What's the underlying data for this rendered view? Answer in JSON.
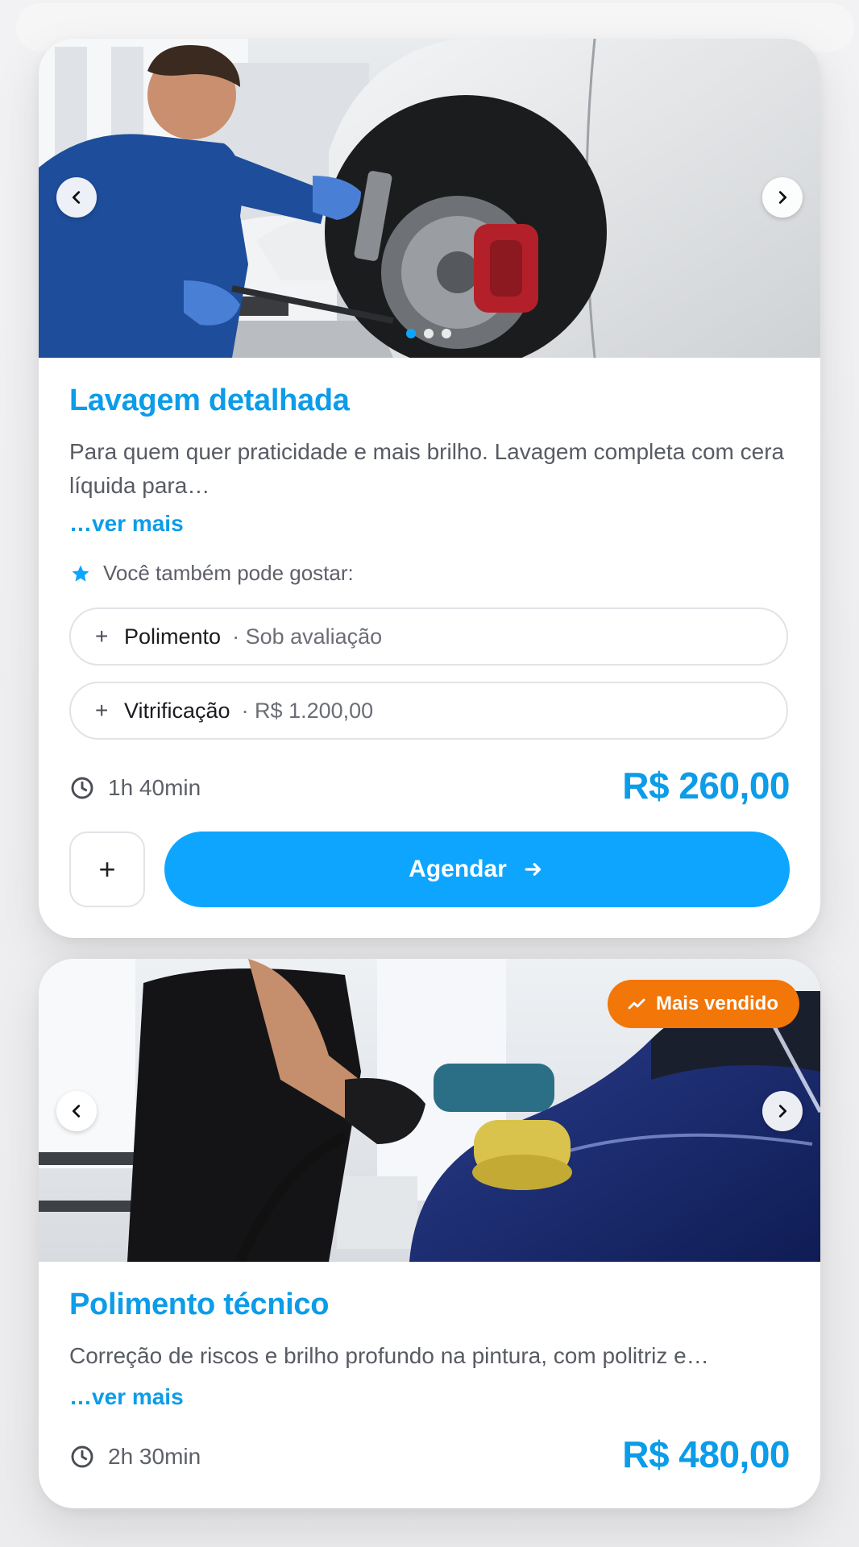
{
  "services": [
    {
      "title": "Lavagem detalhada",
      "description": "Para quem quer praticidade e mais brilho. Lavagem completa com cera líquida para…",
      "more_label": "…ver mais",
      "suggest_label": "Você também pode gostar:",
      "suggestions": [
        {
          "name": "Polimento",
          "detail": "· Sob avaliação"
        },
        {
          "name": "Vitrificação",
          "detail": "· R$ 1.200,00"
        }
      ],
      "duration": "1h 40min",
      "price": "R$ 260,00",
      "add_label": "+",
      "book_label": "Agendar",
      "carousel": {
        "slide": 1,
        "total": 3
      }
    },
    {
      "title": "Polimento técnico",
      "description": "Correção de riscos e brilho profundo na pintura, com politriz e…",
      "more_label": "…ver mais",
      "badge": "Mais vendido",
      "duration": "2h 30min",
      "price": "R$ 480,00"
    }
  ],
  "icons": {
    "prev": "chevron-left-icon",
    "next": "chevron-right-icon",
    "star": "star-icon",
    "clock": "clock-icon",
    "arrow": "arrow-right-icon",
    "trend": "trending-up-icon"
  },
  "colors": {
    "accent": "#0ea5ff",
    "title": "#0c9ce8",
    "badge": "#f27708",
    "text_muted": "#575b63"
  }
}
